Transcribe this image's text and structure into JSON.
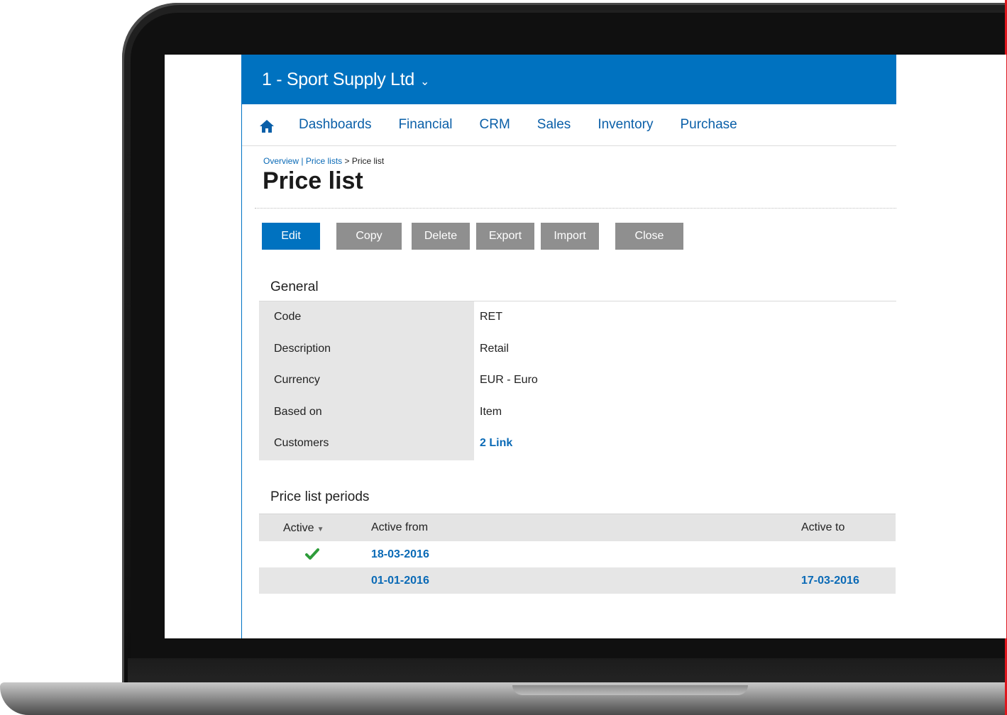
{
  "app": {
    "company": "1 - Sport Supply Ltd",
    "company_chevron_icon": "chevron-down-icon",
    "colors": {
      "brand": "#0072c0",
      "link": "#0a6ab6",
      "button_gray": "#8f8f8f",
      "check_green": "#2e9c3a"
    }
  },
  "nav": {
    "home_icon": "home-icon",
    "items": [
      {
        "label": "Dashboards"
      },
      {
        "label": "Financial"
      },
      {
        "label": "CRM"
      },
      {
        "label": "Sales"
      },
      {
        "label": "Inventory"
      },
      {
        "label": "Purchase"
      }
    ]
  },
  "breadcrumb": {
    "overview": "Overview",
    "divider": " | ",
    "price_lists": "Price lists",
    "current": " > Price list"
  },
  "page": {
    "title": "Price list"
  },
  "toolbar": {
    "edit": "Edit",
    "copy": "Copy",
    "delete": "Delete",
    "export": "Export",
    "import": "Import",
    "close": "Close"
  },
  "general": {
    "heading": "General",
    "rows": [
      {
        "label": "Code",
        "value": "RET"
      },
      {
        "label": "Description",
        "value": "Retail"
      },
      {
        "label": "Currency",
        "value": "EUR - Euro"
      },
      {
        "label": "Based on",
        "value": "Item"
      },
      {
        "label": "Customers",
        "value": "2 Link"
      }
    ]
  },
  "periods": {
    "heading": "Price list periods",
    "columns": {
      "active": "Active",
      "active_from": "Active from",
      "active_to": "Active to"
    },
    "sort_icon": "sort-down-icon",
    "rows": [
      {
        "active": true,
        "active_from": "18-03-2016",
        "active_to": ""
      },
      {
        "active": false,
        "active_from": "01-01-2016",
        "active_to": "17-03-2016"
      }
    ]
  }
}
